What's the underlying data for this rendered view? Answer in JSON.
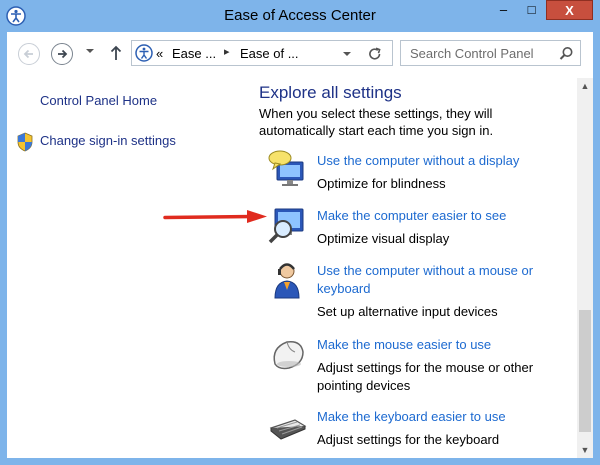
{
  "window": {
    "title": "Ease of Access Center",
    "minimize_glyph": "–",
    "maximize_glyph": "□",
    "close_glyph": "X"
  },
  "address": {
    "prefix": "«",
    "crumbs": [
      "Ease ...",
      "Ease of ..."
    ],
    "separator": "▸"
  },
  "search": {
    "placeholder": "Search Control Panel"
  },
  "left_pane": {
    "home_link": "Control Panel Home",
    "signin_link": "Change sign-in settings"
  },
  "main": {
    "title": "Explore all settings",
    "description": "When you select these settings, they will automatically start each time you sign in.",
    "items": [
      {
        "link": "Use the computer without a display",
        "desc": "Optimize for blindness",
        "icon": "display-speech-icon"
      },
      {
        "link": "Make the computer easier to see",
        "desc": "Optimize visual display",
        "icon": "magnifier-monitor-icon"
      },
      {
        "link": "Use the computer without a mouse or keyboard",
        "desc": "Set up alternative input devices",
        "icon": "person-headset-icon"
      },
      {
        "link": "Make the mouse easier to use",
        "desc": "Adjust settings for the mouse or other pointing devices",
        "icon": "mouse-icon"
      },
      {
        "link": "Make the keyboard easier to use",
        "desc": "Adjust settings for the keyboard",
        "icon": "keyboard-icon"
      }
    ]
  },
  "colors": {
    "titlebar": "#7eb4ea",
    "link": "#1d6ad0",
    "heading": "#1e3287",
    "arrow": "#e02b1f",
    "close": "#c74f3e"
  }
}
